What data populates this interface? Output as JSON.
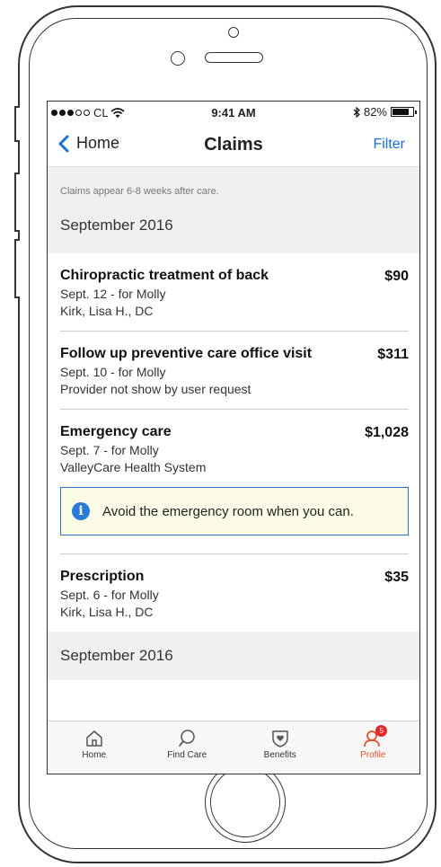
{
  "status_bar": {
    "carrier": "CL",
    "time": "9:41 AM",
    "battery": "82%",
    "battery_level": 0.82
  },
  "nav": {
    "back_label": "Home",
    "title": "Claims",
    "filter_label": "Filter"
  },
  "intro": {
    "note": "Claims appear 6-8 weeks after care.",
    "month": "September 2016"
  },
  "claims": [
    {
      "title": "Chiropractic treatment of back",
      "amount": "$90",
      "date": "Sept. 12 - for Molly",
      "provider": "Kirk, Lisa H., DC"
    },
    {
      "title": "Follow up preventive care office visit",
      "amount": "$311",
      "date": "Sept. 10 - for Molly",
      "provider": "Provider not show by user request"
    },
    {
      "title": "Emergency care",
      "amount": "$1,028",
      "date": "Sept. 7 - for Molly",
      "provider": "ValleyCare Health System"
    },
    {
      "title": "Prescription",
      "amount": "$35",
      "date": "Sept. 6 - for Molly",
      "provider": "Kirk, Lisa H., DC"
    }
  ],
  "notice": {
    "text": "Avoid the emergency room when you can."
  },
  "next_month": "September 2016",
  "tabs": [
    {
      "label": "Home",
      "icon": "home-icon"
    },
    {
      "label": "Find Care",
      "icon": "search-icon"
    },
    {
      "label": "Benefits",
      "icon": "shield-heart-icon"
    },
    {
      "label": "Profile",
      "icon": "profile-icon",
      "badge": "5",
      "active": true
    }
  ],
  "colors": {
    "accent": "#1a6fd6",
    "active_tab": "#e2522f",
    "badge": "#e02b2b",
    "notice_bg": "#fbfbe8"
  }
}
